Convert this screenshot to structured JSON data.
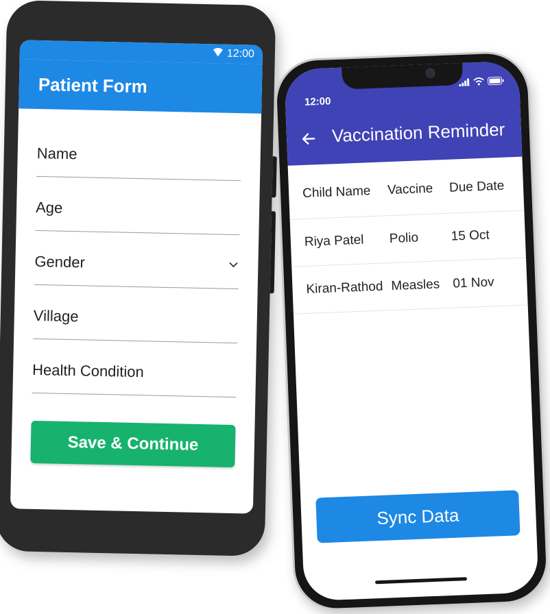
{
  "android": {
    "status_time": "12:00",
    "title": "Patient Form",
    "fields": [
      {
        "label": "Name"
      },
      {
        "label": "Age"
      },
      {
        "label": "Gender"
      },
      {
        "label": "Village"
      },
      {
        "label": "Health Condition"
      }
    ],
    "save_label": "Save & Continue",
    "colors": {
      "appbar": "#1e88e5",
      "button": "#17b26e"
    }
  },
  "iphone": {
    "status_time": "12:00",
    "title": "Vaccination Reminder",
    "table": {
      "headers": [
        "Child Name",
        "Vaccine",
        "Due Date"
      ],
      "rows": [
        [
          "Riya Patel",
          "Polio",
          "15 Oct"
        ],
        [
          "Kiran-Rathod",
          "Measles",
          "01 Nov"
        ]
      ]
    },
    "sync_label": "Sync Data",
    "colors": {
      "header": "#3f43b5",
      "button": "#1e88e5"
    }
  },
  "icons": [
    "wifi-icon",
    "signal-icon",
    "battery-icon",
    "back-arrow-icon",
    "chevron-down-icon"
  ]
}
